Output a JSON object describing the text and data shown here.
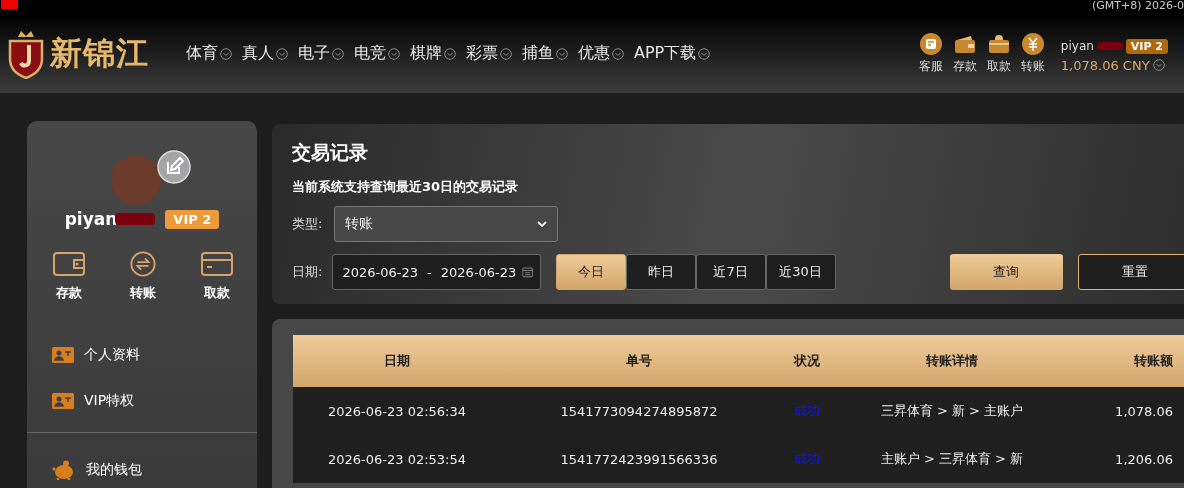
{
  "top_bar": {
    "clock": "(GMT+8) 2026-0"
  },
  "header": {
    "logo_text": "新锦江",
    "nav": [
      {
        "label": "体育"
      },
      {
        "label": "真人"
      },
      {
        "label": "电子"
      },
      {
        "label": "电竞"
      },
      {
        "label": "棋牌"
      },
      {
        "label": "彩票"
      },
      {
        "label": "捕鱼"
      },
      {
        "label": "优惠"
      },
      {
        "label": "APP下载"
      }
    ],
    "actions": [
      {
        "kind": "service",
        "label": "客服"
      },
      {
        "kind": "deposit",
        "label": "存款"
      },
      {
        "kind": "withdraw",
        "label": "取款"
      },
      {
        "kind": "transfer",
        "label": "转账"
      }
    ],
    "user": {
      "name": "piyan",
      "vip": "VIP 2",
      "balance": "1,078.06 CNY"
    }
  },
  "sidebar": {
    "user": {
      "name": "piyan",
      "vip": "VIP 2"
    },
    "actions": [
      {
        "kind": "deposit",
        "label": "存款"
      },
      {
        "kind": "transfer",
        "label": "转账"
      },
      {
        "kind": "withdraw",
        "label": "取款"
      }
    ],
    "menu": [
      {
        "kind": "card",
        "label": "个人资料"
      },
      {
        "kind": "card",
        "label": "VIP特权"
      }
    ],
    "wallet": {
      "label": "我的钱包"
    }
  },
  "filters": {
    "title": "交易记录",
    "note": "当前系统支持查询最近30日的交易记录",
    "type_label": "类型:",
    "type_value": "转账",
    "date_label": "日期:",
    "date_from": "2026-06-23",
    "date_separator": "-",
    "date_to": "2026-06-23",
    "ranges": [
      {
        "label": "今日",
        "selected": true
      },
      {
        "label": "昨日",
        "selected": false
      },
      {
        "label": "近7日",
        "selected": false
      },
      {
        "label": "近30日",
        "selected": false
      }
    ],
    "query_button": "查询",
    "reset_button": "重置"
  },
  "table": {
    "columns": [
      "日期",
      "单号",
      "状况",
      "转账详情",
      "转账额"
    ],
    "rows": [
      {
        "date": "2026-06-23 02:56:34",
        "number": "1541773094274895872",
        "status": "成功",
        "detail": "三昇体育 > 新 > 主账户",
        "amount": "1,078.06"
      },
      {
        "date": "2026-06-23 02:53:54",
        "number": "1541772423991566336",
        "status": "成功",
        "detail": "主账户 > 三昇体育 > 新",
        "amount": "1,206.06"
      }
    ]
  }
}
